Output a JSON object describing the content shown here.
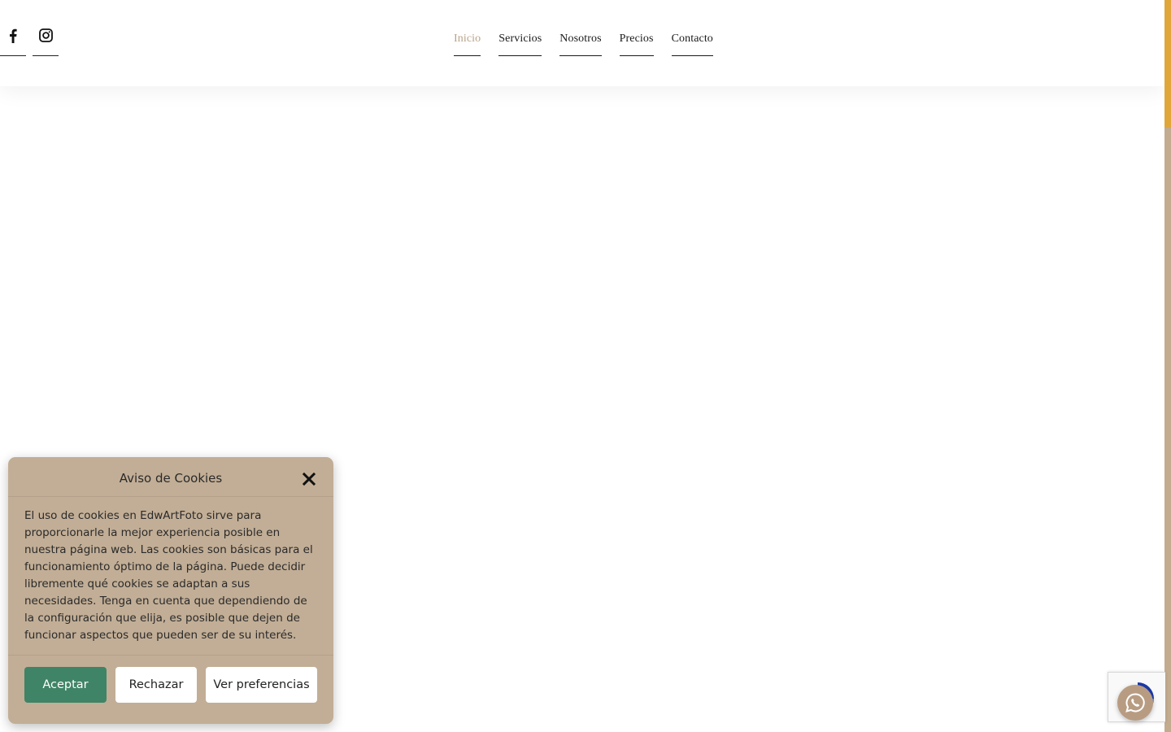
{
  "social": {
    "facebook_icon": "facebook-icon",
    "instagram_icon": "instagram-icon"
  },
  "nav": {
    "items": [
      {
        "label": "Inicio",
        "active": true
      },
      {
        "label": "Servicios",
        "active": false
      },
      {
        "label": "Nosotros",
        "active": false
      },
      {
        "label": "Precios",
        "active": false
      },
      {
        "label": "Contacto",
        "active": false
      }
    ]
  },
  "cookie_banner": {
    "title": "Aviso de Cookies",
    "body": "El uso de cookies en EdwArtFoto sirve para proporcionarle la mejor experiencia posible en nuestra página web. Las cookies son básicas para el funcionamiento óptimo de la página. Puede decidir libremente qué cookies se adaptan a sus necesidades. Tenga en cuenta que dependiendo de la configuración que elija, es posible que dejen de funcionar aspectos que pueden ser de su interés.",
    "accept_label": "Aceptar",
    "reject_label": "Rechazar",
    "preferences_label": "Ver preferencias"
  },
  "colors": {
    "accent": "#b9a48a",
    "banner_bg": "#c2ae96",
    "accept_bg": "#3f8466",
    "scroll_thumb": "#e0a63a",
    "whatsapp_bg": "#b89c82"
  }
}
